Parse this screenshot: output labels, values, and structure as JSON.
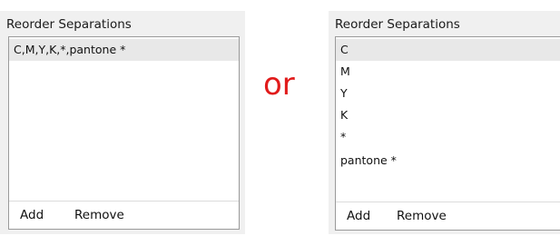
{
  "left_panel": {
    "title": "Reorder Separations",
    "items": [
      {
        "label": "C,M,Y,K,*,pantone *",
        "selected": true
      }
    ],
    "add_label": "Add",
    "remove_label": "Remove"
  },
  "separator_text": "or",
  "separator_color": "#e11b1b",
  "right_panel": {
    "title": "Reorder Separations",
    "items": [
      {
        "label": "C",
        "selected": true
      },
      {
        "label": "M",
        "selected": false
      },
      {
        "label": "Y",
        "selected": false
      },
      {
        "label": "K",
        "selected": false
      },
      {
        "label": "*",
        "selected": false
      },
      {
        "label": "pantone *",
        "selected": false
      }
    ],
    "add_label": "Add",
    "remove_label": "Remove"
  }
}
